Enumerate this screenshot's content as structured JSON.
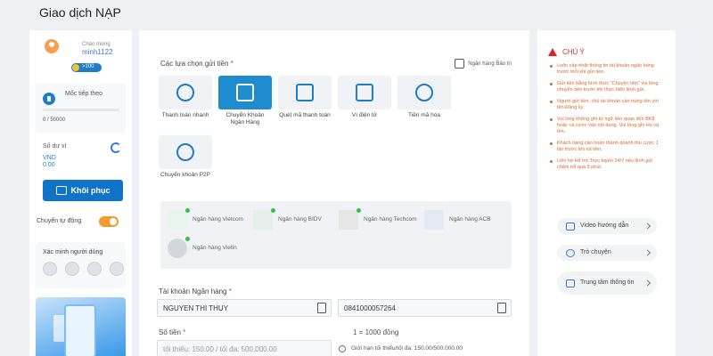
{
  "page": {
    "title": "Giao dịch NẠP"
  },
  "sidebar": {
    "greeting": "Chào mừng",
    "username": "minh1122",
    "level": ">100",
    "progress": {
      "label": "Mốc tiếp theo",
      "value_text": "0 / 50000",
      "fraction": 0
    },
    "balance": {
      "label": "Số dư ví",
      "currency": "VND",
      "amount": "0.00"
    },
    "restore_label": "Khôi phục",
    "auto_transfer": {
      "label": "Chuyển tự động",
      "enabled": true
    },
    "verify_label": "Xác minh người dùng"
  },
  "main": {
    "methods_label": "Các lựa chọn gửi tiền",
    "required_mark": "*",
    "maintenance_label": "Ngân hàng Bảo trì",
    "methods": [
      {
        "label": "Thanh toán nhanh",
        "icon": "fast-pay-icon",
        "active": false
      },
      {
        "label": "Chuyển Khoản Ngân Hàng",
        "icon": "bank-transfer-icon",
        "active": true
      },
      {
        "label": "Quét mã thanh toán",
        "icon": "qr-scan-icon",
        "active": false
      },
      {
        "label": "Ví điện tử",
        "icon": "ewallet-icon",
        "active": false
      },
      {
        "label": "Tiền mã hóa",
        "icon": "crypto-icon",
        "active": false
      },
      {
        "label": "Chuyển khoản P2P",
        "icon": "p2p-icon",
        "active": false
      }
    ],
    "banks": [
      {
        "name": "Ngân hàng Vietcom",
        "color": "#1e8a3c",
        "online": true
      },
      {
        "name": "Ngân hàng BIDV",
        "color": "#2f7f6b",
        "online": true
      },
      {
        "name": "Ngân hàng Techcom",
        "color": "#555555",
        "online": true
      },
      {
        "name": "Ngân hàng ACB",
        "color": "#1d4f9c",
        "online": false
      },
      {
        "name": "Ngân hàng Vietin",
        "color": "#888888",
        "online": true
      }
    ],
    "account_label": "Tài khoản Ngân hàng",
    "account_name": "NGUYEN THI THUY",
    "account_number": "0841000057264",
    "amount_label": "Số tiền",
    "amount_placeholder": "tối thiểu: 150.00 / tối đa: 500,000.00",
    "unit_hint": "1 = 1000 đồng",
    "limit_hint": "Giới hạn tối thiểu/tối đa: 150.00/500.000.00"
  },
  "notice": {
    "title": "CHÚ Ý",
    "items": [
      "Luôn cập nhật thông tin tài khoản ngân hàng trước mỗi khi gửi tiền.",
      "Gửi tiền bằng hình thức \"Chuyển tiền\" vui lòng chuyển tiền trước khi thực hiện lệnh gửi.",
      "Người gửi tiền, chủ tài khoản cần trùng tên với tên Đăng ký.",
      "Vui lòng không ghi từ ngữ liên quan đến BK8 hoặc cá cược vào nội dung. Vui lòng ghi Họ và tên.",
      "Khách hàng cần hoàn thành doanh thu cược 1 lần trước khi rút tiền.",
      "Liên hệ Hỗ trợ Trực tuyến 24/7 nếu lệnh gửi chậm trễ quá 5 phút."
    ],
    "buttons": [
      {
        "label": "Video hướng dẫn",
        "icon": "video-icon"
      },
      {
        "label": "Trò chuyện",
        "icon": "chat-icon"
      },
      {
        "label": "Trung tâm thông tin",
        "icon": "info-center-icon"
      }
    ]
  }
}
